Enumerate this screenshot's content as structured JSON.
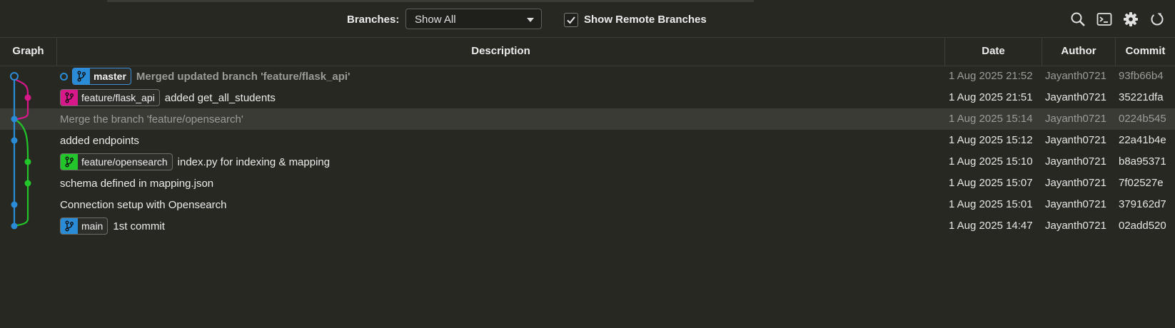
{
  "toolbar": {
    "branches_label": "Branches:",
    "branches_value": "Show All",
    "show_remote_checked": true,
    "show_remote_label": "Show Remote Branches",
    "icons": [
      "search-icon",
      "terminal-icon",
      "gear-icon",
      "refresh-icon"
    ]
  },
  "columns": {
    "graph": "Graph",
    "description": "Description",
    "date": "Date",
    "author": "Author",
    "commit": "Commit"
  },
  "colors": {
    "blue": "#2a8bd6",
    "magenta": "#d8178a",
    "green": "#22c52a"
  },
  "commits": [
    {
      "description": "Merged updated branch 'feature/flask_api'",
      "refs": [
        "master"
      ],
      "date": "1 Aug 2025 21:52",
      "author": "Jayanth0721",
      "hash": "93fb66b4"
    },
    {
      "description": "added get_all_students",
      "refs": [
        "feature/flask_api"
      ],
      "date": "1 Aug 2025 21:51",
      "author": "Jayanth0721",
      "hash": "35221dfa"
    },
    {
      "description": "Merge the branch 'feature/opensearch'",
      "refs": [],
      "date": "1 Aug 2025 15:14",
      "author": "Jayanth0721",
      "hash": "0224b545"
    },
    {
      "description": "added endpoints",
      "refs": [],
      "date": "1 Aug 2025 15:12",
      "author": "Jayanth0721",
      "hash": "22a41b4e"
    },
    {
      "description": "index.py for indexing & mapping",
      "refs": [
        "feature/opensearch"
      ],
      "date": "1 Aug 2025 15:10",
      "author": "Jayanth0721",
      "hash": "b8a95371"
    },
    {
      "description": "schema defined in mapping.json",
      "refs": [],
      "date": "1 Aug 2025 15:07",
      "author": "Jayanth0721",
      "hash": "7f02527e"
    },
    {
      "description": "Connection setup with Opensearch",
      "refs": [],
      "date": "1 Aug 2025 15:01",
      "author": "Jayanth0721",
      "hash": "379162d7"
    },
    {
      "description": "1st commit",
      "refs": [
        "main"
      ],
      "date": "1 Aug 2025 14:47",
      "author": "Jayanth0721",
      "hash": "02add520"
    }
  ]
}
